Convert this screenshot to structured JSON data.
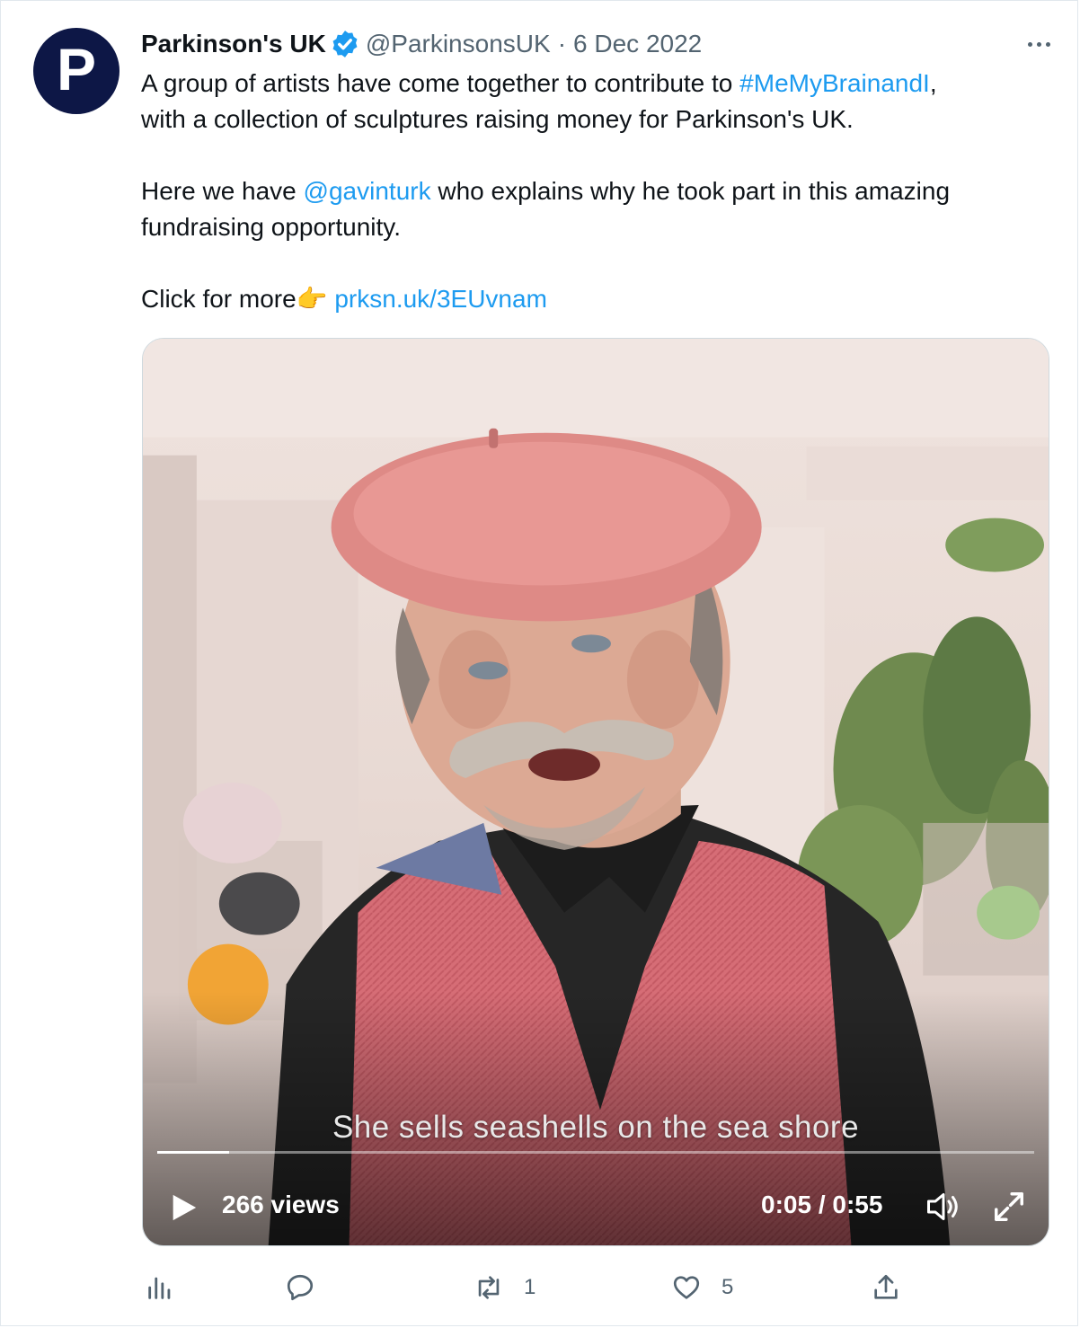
{
  "tweet": {
    "author_name": "Parkinson's UK",
    "avatar_letter": "P",
    "handle": "@ParkinsonsUK",
    "separator": "·",
    "date": "6 Dec 2022",
    "body": {
      "line1_text": "A group of artists have come together to contribute to ",
      "hashtag": "#MeMyBrainandI",
      "line1_end": ",",
      "line2": "with a collection of sculptures raising money for Parkinson's UK.",
      "para2_start": "Here we have ",
      "mention": "@gavinturk",
      "para2_end": " who explains why he took part in this amazing",
      "para2_line2": "fundraising opportunity.",
      "para3_text": "Click for more",
      "para3_emoji": "👉",
      "para3_link": "prksn.uk/3EUvnam"
    }
  },
  "video": {
    "caption": "She sells seashells on the sea shore",
    "views": "266 views",
    "time": "0:05 / 0:55",
    "progress_fraction": 0.082
  },
  "actions": {
    "views_icon": "analytics-icon",
    "reply_icon": "reply-icon",
    "reply_count": "",
    "retweet_icon": "retweet-icon",
    "retweet_count": "1",
    "like_icon": "heart-icon",
    "like_count": "5",
    "share_icon": "share-icon"
  },
  "colors": {
    "link": "#1d9bf0",
    "muted": "#536471",
    "avatar_bg": "#0d1746",
    "verified": "#1d9bf0"
  }
}
